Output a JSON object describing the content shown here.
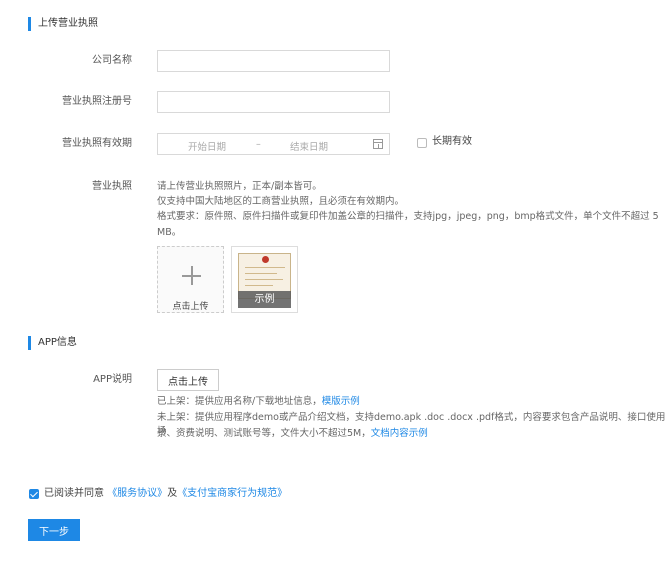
{
  "section1": {
    "title": "上传营业执照"
  },
  "form": {
    "company_name_label": "公司名称",
    "company_name_value": "",
    "reg_no_label": "营业执照注册号",
    "reg_no_value": "",
    "validity_label": "营业执照有效期",
    "start_date_placeholder": "开始日期",
    "date_sep": "–",
    "end_date_placeholder": "结束日期",
    "long_term_label": "长期有效",
    "license_label": "营业执照",
    "license_hint_1": "请上传营业执照照片，正本/副本皆可。",
    "license_hint_2": "仅支持中国大陆地区的工商营业执照，且必须在有效期内。",
    "license_hint_3": "格式要求：原件照、原件扫描件或复印件加盖公章的扫描件，支持jpg，jpeg，png，bmp格式文件，单个文件不超过 5",
    "license_hint_4": "MB。",
    "upload_label": "点击上传",
    "example_label": "示例"
  },
  "section2": {
    "title": "APP信息"
  },
  "app": {
    "desc_label": "APP说明",
    "upload_button": "点击上传",
    "online_text": "已上架：提供应用名称/下载地址信息，",
    "online_link": "模版示例",
    "offline_text_1": "未上架：提供应用程序demo或产品介绍文档，支持demo.apk .doc .docx .pdf格式，内容要求包含产品说明、接口使用场",
    "offline_text_2": "景、资费说明、测试账号等，文件大小不超过5M，",
    "offline_link": "文档内容示例"
  },
  "agreement": {
    "checked": true,
    "prefix": "已阅读并同意",
    "link1": "《服务协议》",
    "and": "及",
    "link2": "《支付宝商家行为规范》"
  },
  "next_button": "下一步",
  "colors": {
    "accent": "#1e88e5"
  }
}
